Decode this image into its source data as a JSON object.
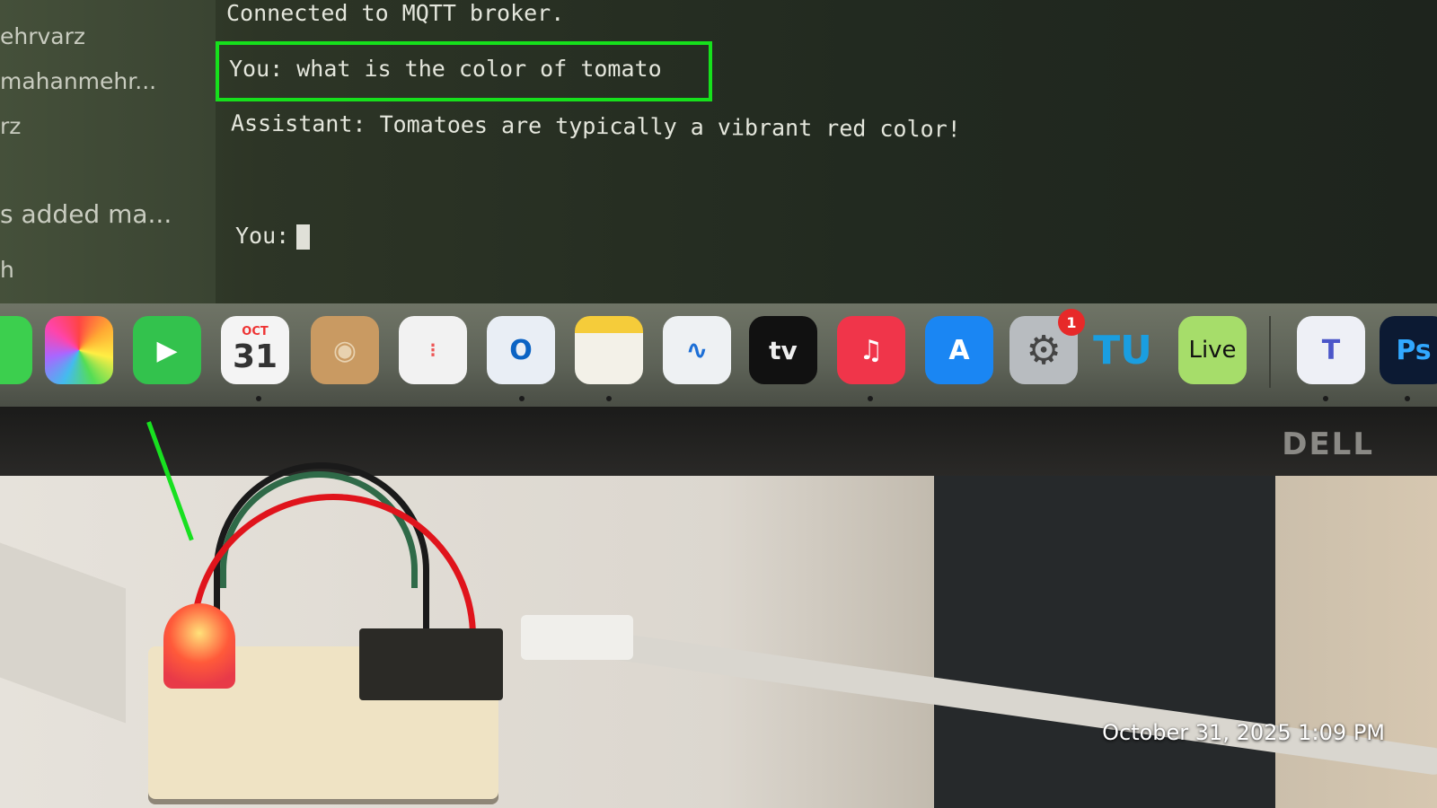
{
  "sidebar": {
    "items": [
      "ehrvarz",
      "mahanmehr...",
      "rz",
      "s added ma...",
      "h"
    ]
  },
  "terminal": {
    "lines": [
      "Connected to MQTT broker.",
      "You: what is the color of tomato",
      "Assistant: Tomatoes are typically a vibrant red color!"
    ],
    "prompt": "You:"
  },
  "dock": {
    "calendar_month": "OCT",
    "calendar_day": "31",
    "tv_label": "tv",
    "live_label": "Live",
    "settings_badge": "1",
    "ps_label": "Ps",
    "tu_label": "TU"
  },
  "monitor_brand": "DELL",
  "timestamp": "October 31, 2025 1:09 PM",
  "colors": {
    "highlight": "#16e01c",
    "led": "#ff5a3a"
  }
}
